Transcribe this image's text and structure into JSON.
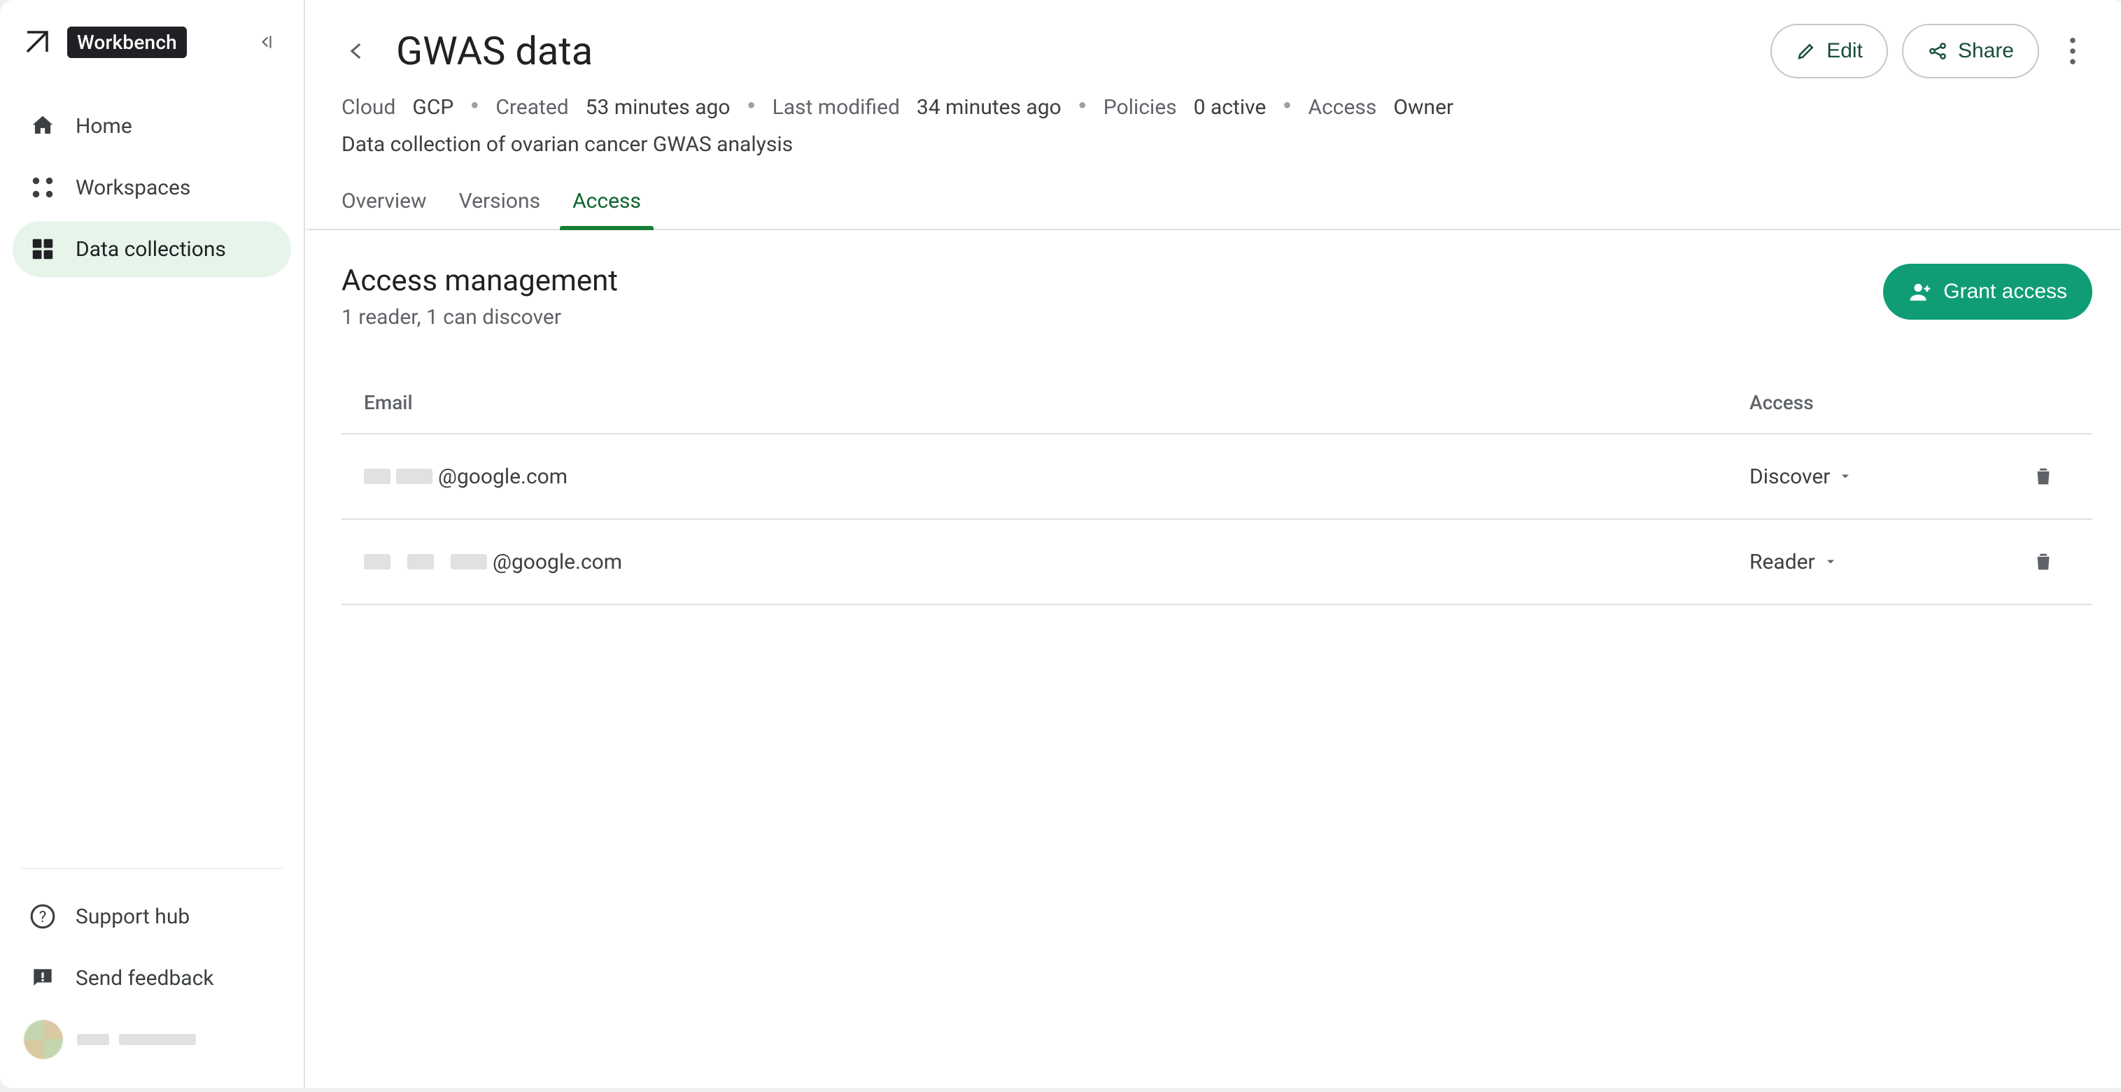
{
  "brand": {
    "name": "Workbench"
  },
  "sidebar": {
    "items": [
      {
        "label": "Home"
      },
      {
        "label": "Workspaces"
      },
      {
        "label": "Data collections"
      }
    ],
    "active_index": 2,
    "support_label": "Support hub",
    "feedback_label": "Send feedback"
  },
  "header": {
    "title": "GWAS data",
    "edit_label": "Edit",
    "share_label": "Share",
    "meta": {
      "cloud_label": "Cloud",
      "cloud_val": "GCP",
      "created_label": "Created",
      "created_val": "53 minutes ago",
      "modified_label": "Last modified",
      "modified_val": "34 minutes ago",
      "policies_label": "Policies",
      "policies_val": "0 active",
      "access_label": "Access",
      "access_val": "Owner"
    },
    "description": "Data collection of ovarian cancer GWAS analysis"
  },
  "tabs": {
    "items": [
      "Overview",
      "Versions",
      "Access"
    ],
    "active_index": 2
  },
  "access_mgmt": {
    "title": "Access management",
    "subtitle": "1 reader, 1 can discover",
    "grant_label": "Grant access",
    "col_email": "Email",
    "col_access": "Access",
    "rows": [
      {
        "email_suffix": "@google.com",
        "access": "Discover"
      },
      {
        "email_suffix": "@google.com",
        "access": "Reader"
      }
    ]
  }
}
